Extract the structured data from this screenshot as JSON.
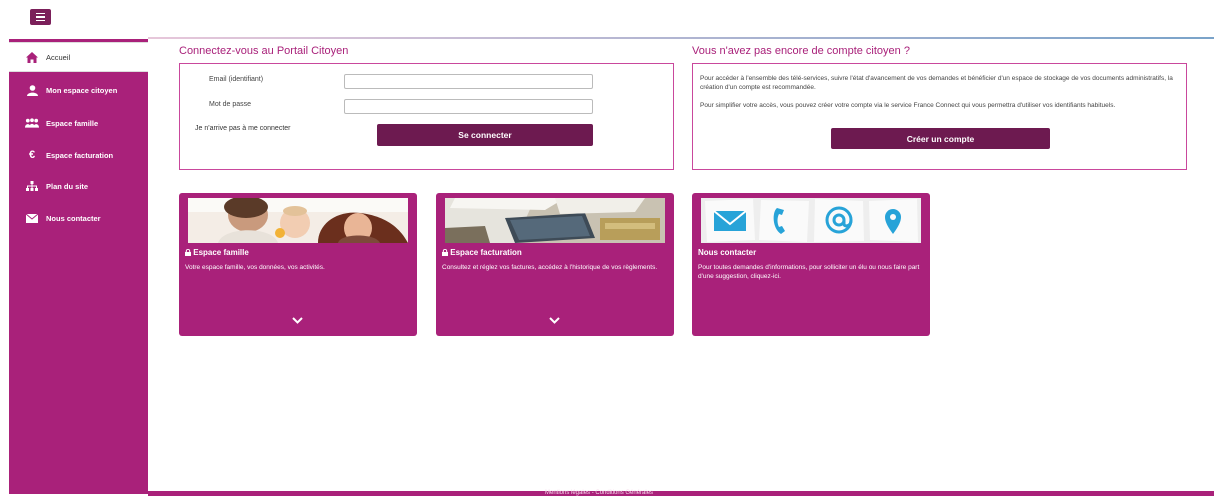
{
  "header": {
    "menu_icon": "hamburger-menu-icon"
  },
  "sidebar": {
    "items": [
      {
        "label": "Accueil",
        "icon": "home-icon",
        "active": true
      },
      {
        "label": "Mon espace citoyen",
        "icon": "user-icon",
        "active": false
      },
      {
        "label": "Espace famille",
        "icon": "family-icon",
        "active": false
      },
      {
        "label": "Espace facturation",
        "icon": "euro-icon",
        "active": false
      },
      {
        "label": "Plan du site",
        "icon": "sitemap-icon",
        "active": false
      },
      {
        "label": "Nous contacter",
        "icon": "envelope-icon",
        "active": false
      }
    ]
  },
  "login": {
    "title": "Connectez-vous au Portail Citoyen",
    "email_label": "Email (identifiant)",
    "email_value": "",
    "password_label": "Mot de passe",
    "password_value": "",
    "forgot_label": "Je n'arrive pas à me connecter",
    "submit_label": "Se connecter"
  },
  "signup": {
    "title": "Vous n'avez pas encore de compte citoyen ?",
    "paragraph1": "Pour accéder à l'ensemble des télé-services, suivre l'état d'avancement de vos demandes et bénéficier d'un espace de stockage de vos documents administratifs, la création d'un compte est recommandée.",
    "paragraph2": "Pour simplifier votre accès, vous pouvez créer votre compte via le service France Connect qui vous permettra d'utiliser vos identifiants habituels.",
    "button_label": "Créer un compte"
  },
  "tiles": [
    {
      "title": "Espace famille",
      "description": "Votre espace famille, vos données, vos activités.",
      "lock_icon": "lock-icon",
      "chevron": "chevron-down-icon"
    },
    {
      "title": "Espace facturation",
      "description": "Consultez et réglez vos factures, accédez à l'historique de vos règlements.",
      "lock_icon": "lock-icon",
      "chevron": "chevron-down-icon"
    },
    {
      "title": "Nous contacter",
      "description": "Pour toutes demandes d'informations, pour solliciter un élu ou nous faire part d'une suggestion, cliquez-ici."
    }
  ],
  "footer": {
    "text": "Mentions légales - Conditions Générales"
  },
  "colors": {
    "brand": "#a9217a",
    "button": "#6d1a50",
    "border": "#c9479c"
  }
}
